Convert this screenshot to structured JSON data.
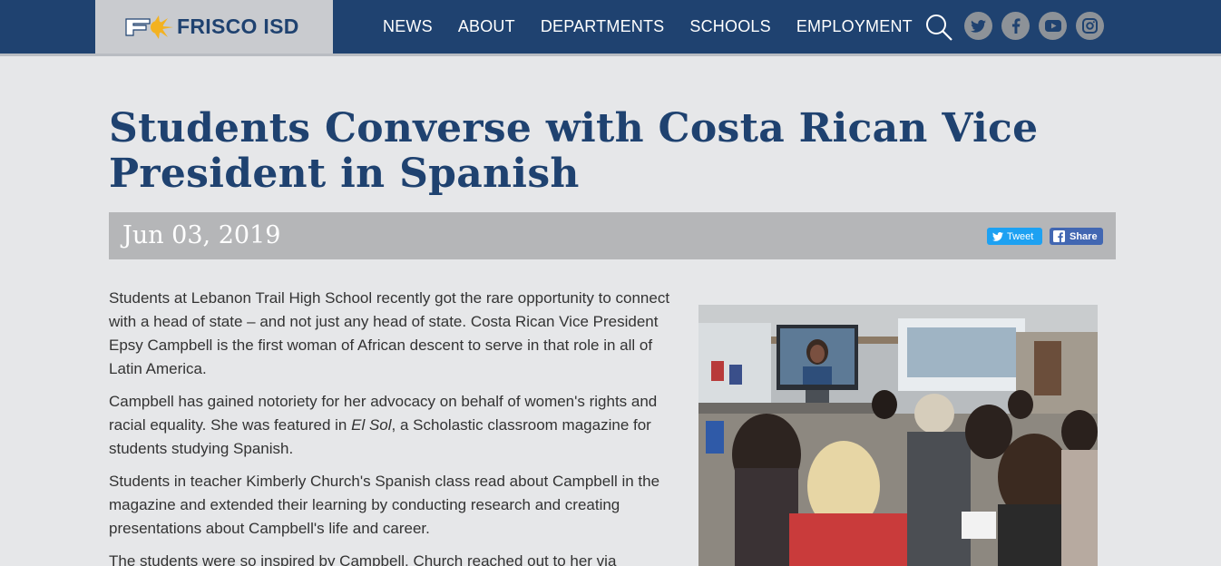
{
  "header": {
    "logo_text": "FRISCO ISD",
    "nav": [
      "NEWS",
      "ABOUT",
      "DEPARTMENTS",
      "SCHOOLS",
      "EMPLOYMENT"
    ],
    "icons": [
      "search-icon",
      "twitter-icon",
      "facebook-icon",
      "youtube-icon",
      "instagram-icon"
    ]
  },
  "article": {
    "title": "Students Converse with Costa Rican Vice President in Spanish",
    "date": "Jun 03, 2019",
    "tweet_label": "Tweet",
    "share_label": "Share",
    "paragraphs": [
      "Students at Lebanon Trail High School recently got the rare opportunity to connect with a head of state – and not just any head of state. Costa Rican Vice President Epsy Campbell is the first woman of African descent to serve in that role in all of Latin America.",
      {
        "before": "Campbell has gained notoriety for her advocacy on behalf of women's rights and racial equality. She was featured in ",
        "em": "El Sol",
        "after": ", a Scholastic classroom magazine for students studying Spanish."
      },
      "Students in teacher Kimberly Church's Spanish class read about Campbell in the magazine and extended their learning by conducting research and creating presentations about Campbell's life and career.",
      "The students were so inspired by Campbell, Church reached out to her via"
    ]
  },
  "colors": {
    "brand_navy": "#1f4270",
    "page_bg": "#e6e7e9",
    "date_bar": "#b5b6b8",
    "twitter": "#1da1f2",
    "facebook": "#4267b2",
    "social_icon_bg": "#8d9298"
  }
}
